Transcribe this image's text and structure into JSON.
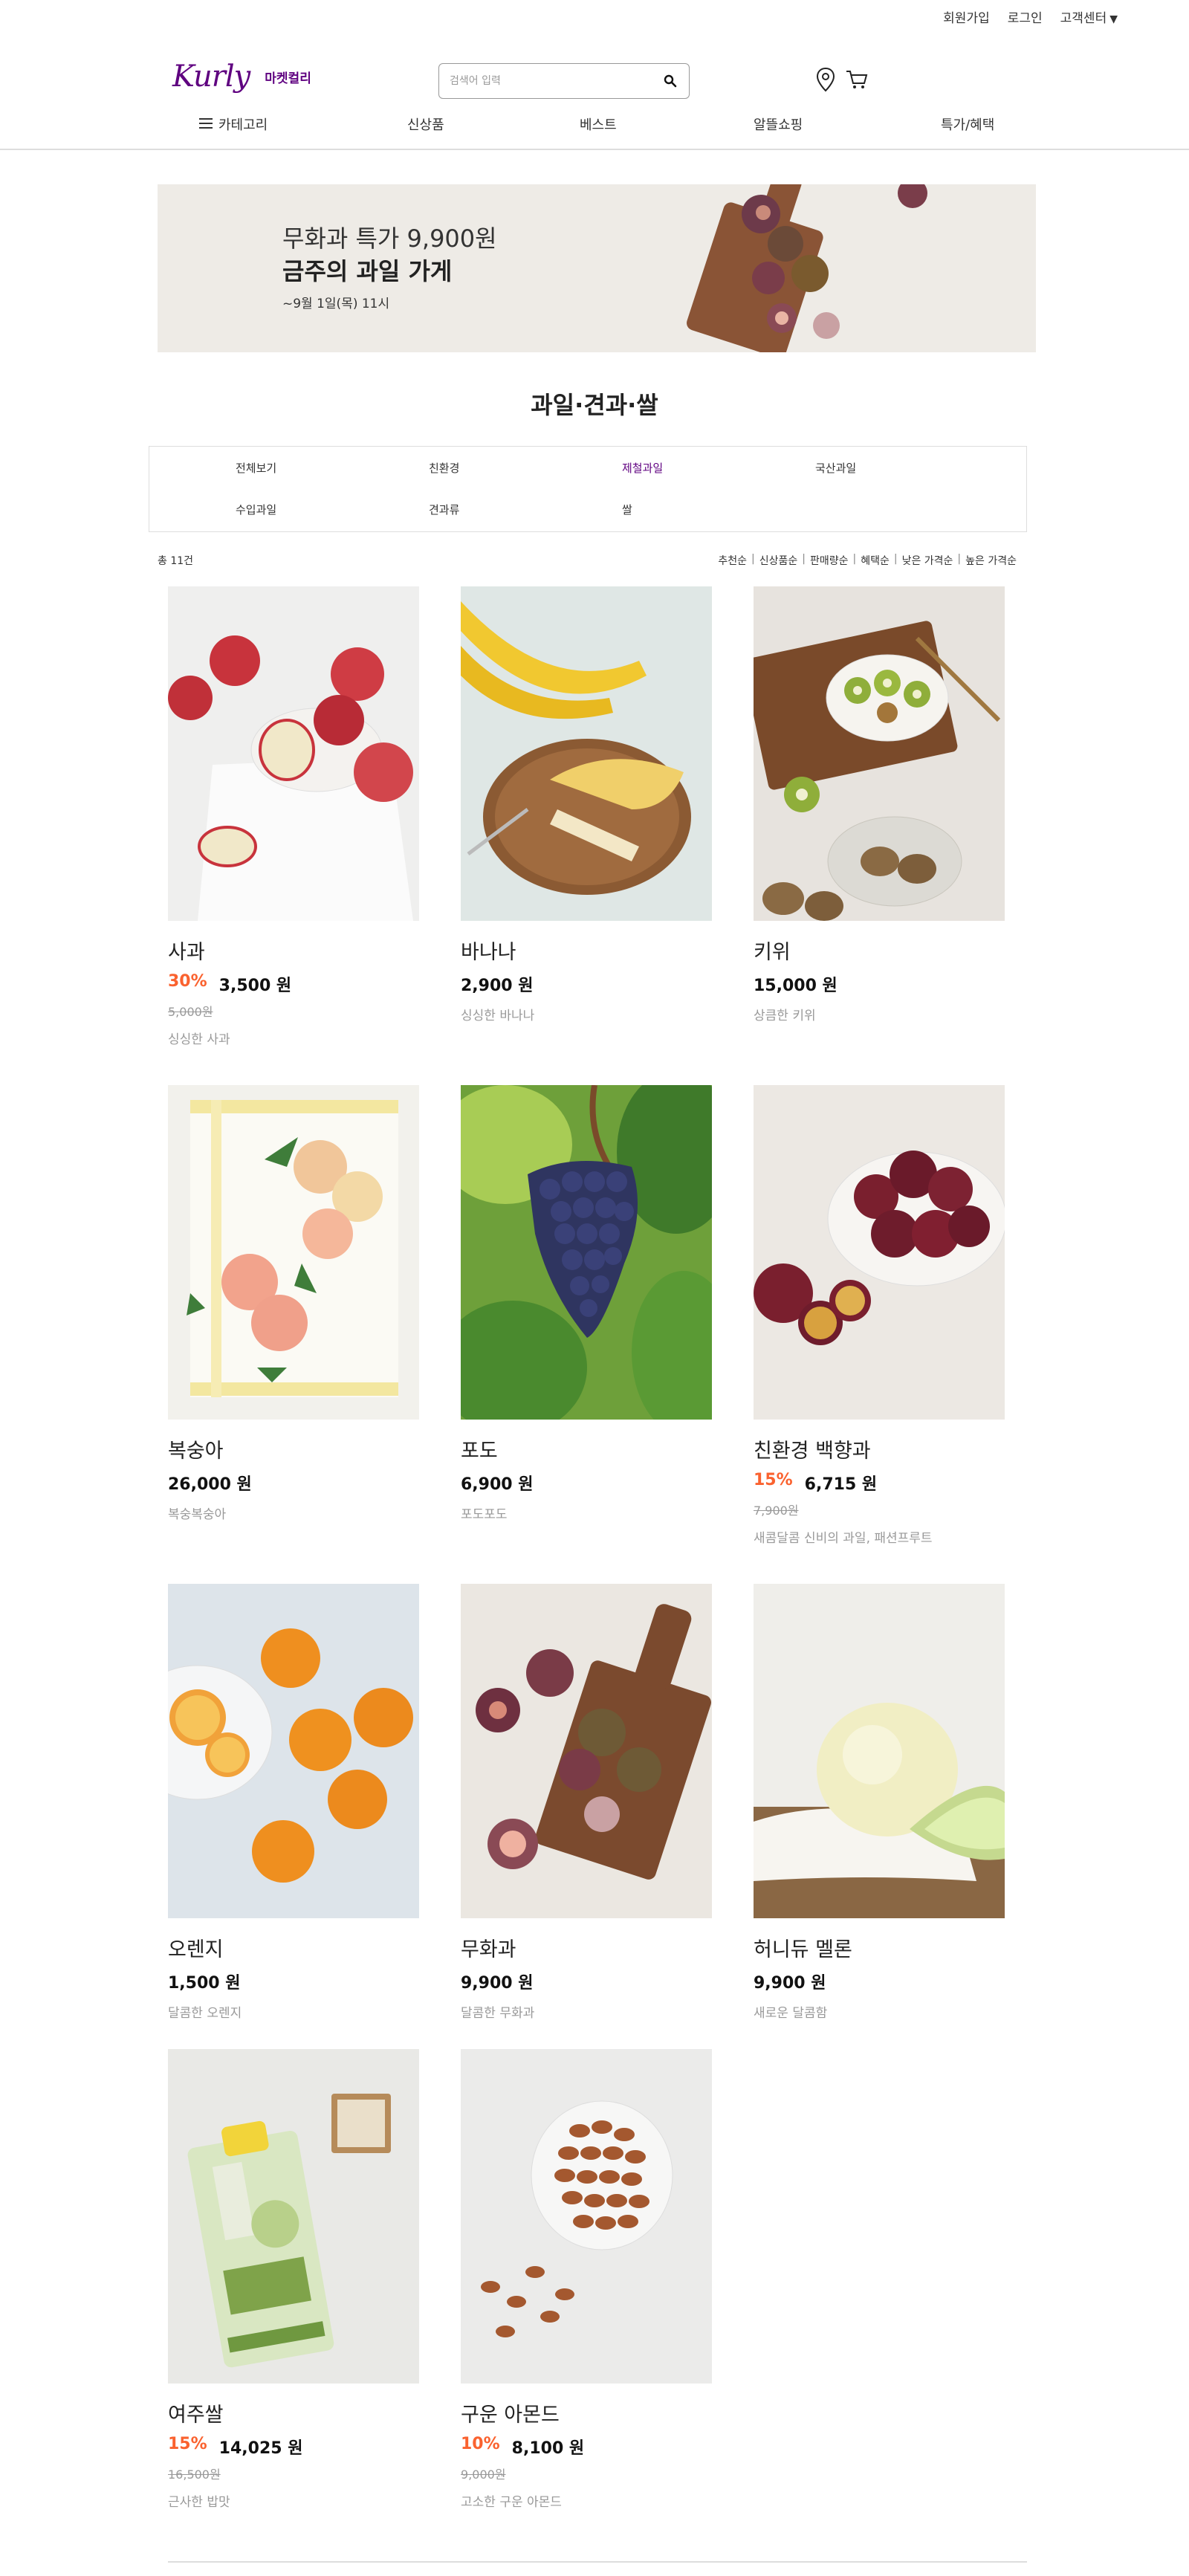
{
  "util": {
    "signup": "회원가입",
    "login": "로그인",
    "cs": "고객센터"
  },
  "header": {
    "logo": "Kurly",
    "market": "마켓컬리",
    "search_placeholder": "검색어 입력"
  },
  "gnb": {
    "category": "카테고리",
    "items": [
      "신상품",
      "베스트",
      "알뜰쇼핑",
      "특가/혜택"
    ]
  },
  "banner": {
    "line1": "무화과 특가 9,900원",
    "line2": "금주의 과일 가게",
    "line3": "~9월 1일(목) 11시"
  },
  "category_title": "과일·견과·쌀",
  "filters": [
    "전체보기",
    "친환경",
    "제철과일",
    "국산과일",
    "수입과일",
    "견과류",
    "쌀"
  ],
  "total_count": "총 11건",
  "sort": [
    "추천순",
    "신상품순",
    "판매량순",
    "혜택순",
    "낮은 가격순",
    "높은 가격순"
  ],
  "products": [
    {
      "name": "사과",
      "discount": "30%",
      "price": "3,500 원",
      "original": "5,000원",
      "desc": "싱싱한 사과"
    },
    {
      "name": "바나나",
      "discount": "",
      "price": "2,900 원",
      "original": "",
      "desc": "싱싱한 바나나"
    },
    {
      "name": "키위",
      "discount": "",
      "price": "15,000 원",
      "original": "",
      "desc": "상큼한 키위"
    },
    {
      "name": "복숭아",
      "discount": "",
      "price": "26,000 원",
      "original": "",
      "desc": "복숭복숭아"
    },
    {
      "name": "포도",
      "discount": "",
      "price": "6,900 원",
      "original": "",
      "desc": "포도포도"
    },
    {
      "name": "친환경 백향과",
      "discount": "15%",
      "price": "6,715 원",
      "original": "7,900원",
      "desc": "새콤달콤 신비의 과일, 패션프루트"
    },
    {
      "name": "오렌지",
      "discount": "",
      "price": "1,500 원",
      "original": "",
      "desc": "달콤한 오렌지"
    },
    {
      "name": "무화과",
      "discount": "",
      "price": "9,900 원",
      "original": "",
      "desc": "달콤한 무화과"
    },
    {
      "name": "허니듀 멜론",
      "discount": "",
      "price": "9,900 원",
      "original": "",
      "desc": "새로운 달콤함"
    },
    {
      "name": "여주쌀",
      "discount": "15%",
      "price": "14,025 원",
      "original": "16,500원",
      "desc": "근사한 밥맛"
    },
    {
      "name": "구운 아몬드",
      "discount": "10%",
      "price": "8,100 원",
      "original": "9,000원",
      "desc": "고소한 구운 아몬드"
    }
  ],
  "colors": {
    "brand": "#5f0080",
    "discount": "#fa622f"
  },
  "icons": [
    "menu-icon",
    "search-icon",
    "location-pin-icon",
    "cart-icon",
    "caret-down-icon"
  ]
}
